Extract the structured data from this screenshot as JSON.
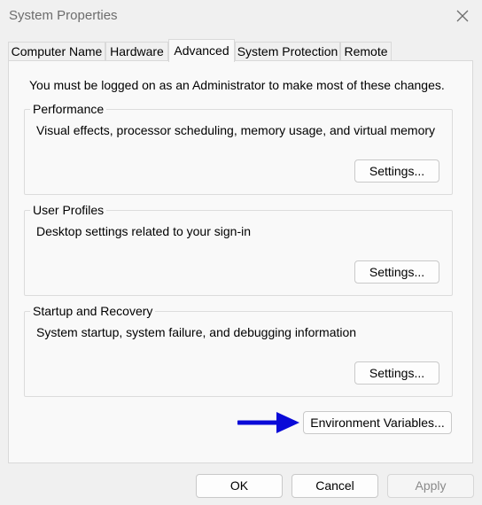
{
  "window": {
    "title": "System Properties"
  },
  "tabs": [
    {
      "label": "Computer Name",
      "active": false
    },
    {
      "label": "Hardware",
      "active": false
    },
    {
      "label": "Advanced",
      "active": true
    },
    {
      "label": "System Protection",
      "active": false
    },
    {
      "label": "Remote",
      "active": false
    }
  ],
  "panel": {
    "admin_note": "You must be logged on as an Administrator to make most of these changes.",
    "groups": [
      {
        "title": "Performance",
        "description": "Visual effects, processor scheduling, memory usage, and virtual memory",
        "button": "Settings..."
      },
      {
        "title": "User Profiles",
        "description": "Desktop settings related to your sign-in",
        "button": "Settings..."
      },
      {
        "title": "Startup and Recovery",
        "description": "System startup, system failure, and debugging information",
        "button": "Settings..."
      }
    ],
    "env_button": "Environment Variables..."
  },
  "footer": {
    "ok": "OK",
    "cancel": "Cancel",
    "apply": "Apply",
    "apply_enabled": false
  },
  "colors": {
    "annotation_arrow": "#0a0ad8"
  },
  "icons": {
    "close": "close-icon",
    "annotation": "right-arrow-icon"
  }
}
